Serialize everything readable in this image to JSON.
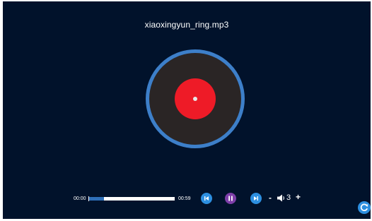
{
  "player": {
    "track_title": "xiaoxingyun_ring.mp3",
    "time_current": "00:00",
    "time_total": "00:59",
    "progress_fraction": 0.17,
    "volume_level": "3",
    "volume_minus_label": "-",
    "volume_plus_label": "+",
    "is_playing": true
  },
  "icons": {
    "prev": "skip-previous-icon",
    "pause": "pause-icon",
    "next": "skip-next-icon",
    "volume": "speaker-icon",
    "refresh": "refresh-icon"
  },
  "colors": {
    "background": "#01122b",
    "disc_ring": "#3d7fc9",
    "disc_body": "#2a2525",
    "disc_label": "#ee1b27",
    "progress_fill": "#2f6fb8",
    "control_blue": "#2d8fe0",
    "control_purple": "#7d3ea8"
  }
}
